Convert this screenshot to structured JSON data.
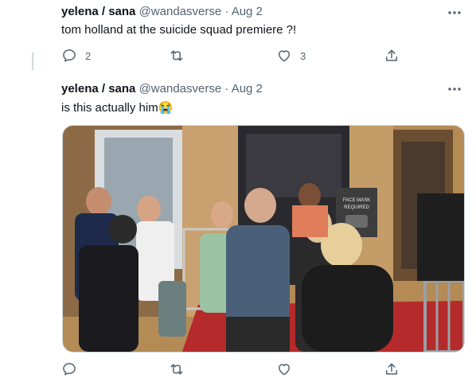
{
  "tweets": [
    {
      "display_name": "yelena / sana",
      "handle": "@wandasverse",
      "separator": "·",
      "date": "Aug 2",
      "text": "tom holland at the suicide squad premiere ?!",
      "reply_count": "2",
      "retweet_count": "",
      "like_count": "3"
    },
    {
      "display_name": "yelena / sana",
      "handle": "@wandasverse",
      "separator": "·",
      "date": "Aug 2",
      "text": "is this actually him",
      "emoji": "😭",
      "reply_count": "",
      "retweet_count": "",
      "like_count": "",
      "photo": {
        "sign_text_1": "FACE MASK",
        "sign_text_2": "REQUIRED"
      }
    }
  ],
  "icons": {
    "more": "more-horizontal-icon",
    "reply": "reply-icon",
    "retweet": "retweet-icon",
    "like": "heart-icon",
    "share": "share-icon"
  },
  "colors": {
    "text": "#0f1419",
    "secondary": "#536471",
    "border": "#cfd9de",
    "carpet": "#b52a2a"
  }
}
